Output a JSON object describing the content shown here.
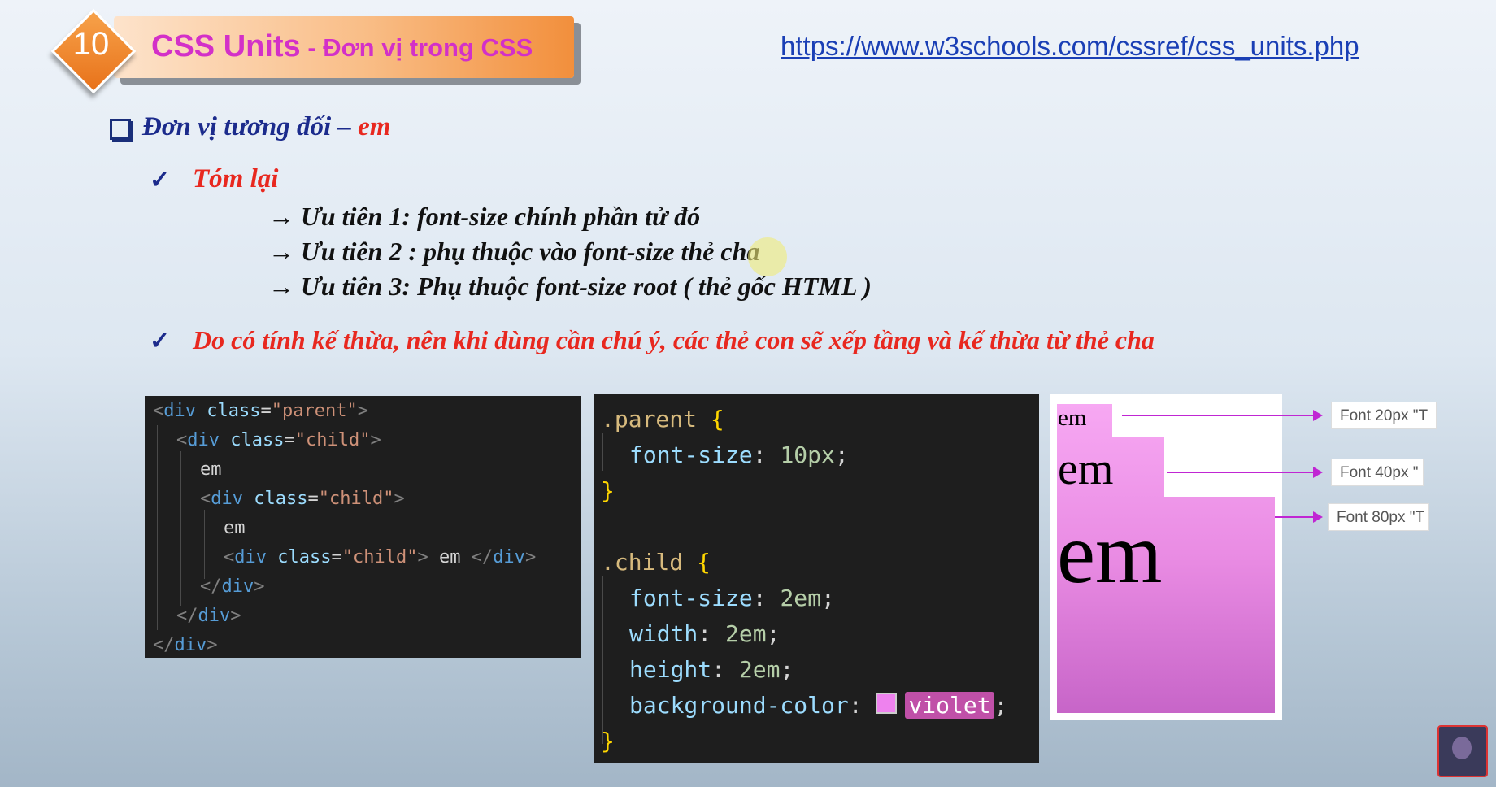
{
  "header": {
    "badge_number": "10",
    "title_main": "CSS Units",
    "title_sub": " - Đơn vị trong CSS",
    "url": "https://www.w3schools.com/cssref/css_units.php"
  },
  "section": {
    "heading_prefix": "Đơn vị tương đối – ",
    "heading_em": "em",
    "summary_label": "Tóm lại",
    "priorities": [
      "→ Ưu tiên 1: font-size chính phần tử đó",
      "→ Ưu tiên 2 : phụ thuộc vào font-size thẻ cha",
      "→ Ưu tiên 3: Phụ thuộc font-size root ( thẻ gốc HTML )"
    ],
    "note": "Do có tính kế thừa, nên khi dùng cần chú ý, các thẻ con sẽ xếp tầng và kế thừa từ thẻ cha",
    "check_glyph": "✓"
  },
  "html_code": {
    "l1_open": "<",
    "l1_tag": "div",
    "l1_attr": " class",
    "l1_eq": "=",
    "l1_val": "\"parent\"",
    "l1_close": ">",
    "child_val": "\"child\"",
    "text_em": "em",
    "inner_text": " em ",
    "end_div": "</div>",
    "end_open": "</",
    "end_close": ">"
  },
  "css_code": {
    "parent_sel": ".parent",
    "open_brace": "{",
    "close_brace": "}",
    "font_size_prop": "font-size",
    "parent_fs": "10px",
    "child_sel": ".child",
    "child_fs": "2em",
    "width_prop": "width",
    "width_val": "2em",
    "height_prop": "height",
    "height_val": "2em",
    "bg_prop": "background-color",
    "bg_val": "violet",
    "colon": ":",
    "semi": ";"
  },
  "demo": {
    "em_text": "em",
    "font_labels": [
      "Font   20px \"T",
      "Font   40px \"",
      "Font   80px \"T"
    ],
    "accent_color": "#c026d3"
  }
}
